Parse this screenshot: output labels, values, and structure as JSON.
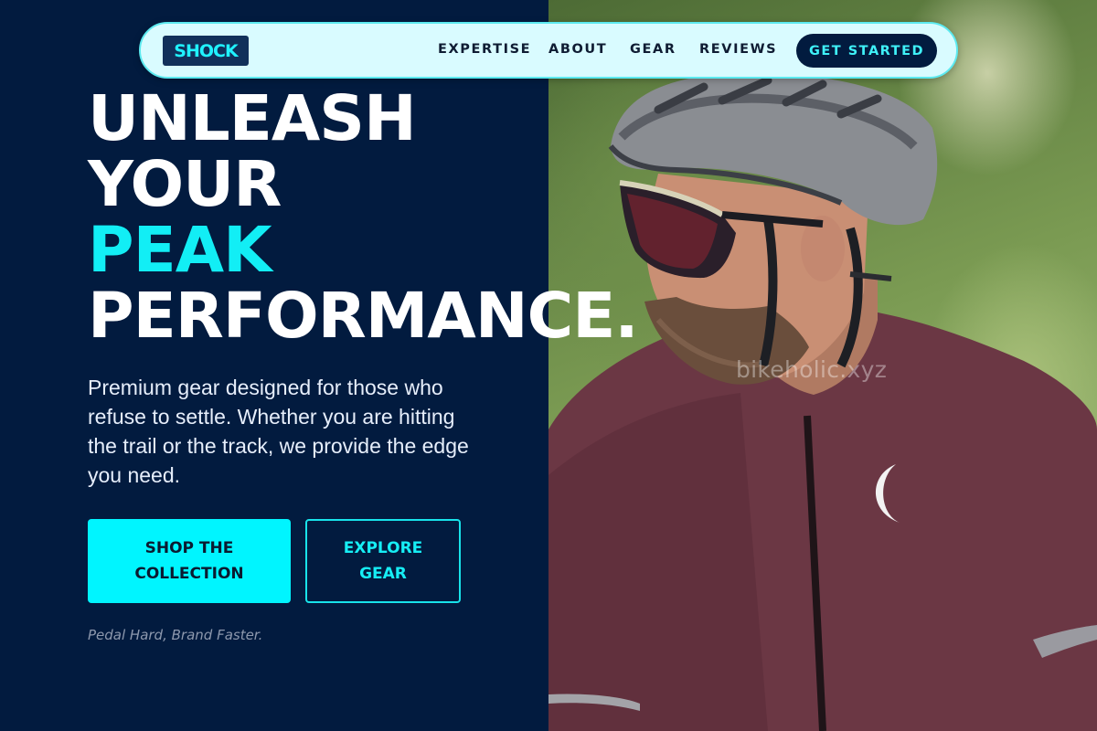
{
  "nav": {
    "logo": "SHOCK",
    "links": [
      "EXPERTISE",
      "ABOUT",
      "GEAR",
      "REVIEWS"
    ],
    "cta": "GET STARTED"
  },
  "hero": {
    "headline": {
      "line1": "UNLEASH",
      "line2": "YOUR",
      "line3": "PEAK",
      "line4": "PERFORMANCE."
    },
    "subtext": "Premium gear designed for those who refuse to settle. Whether you are hitting the trail or the track, we provide the edge you need.",
    "primary_button": "SHOP THE COLLECTION",
    "secondary_button": "EXPLORE GEAR",
    "tagline": "Pedal Hard, Brand Faster.",
    "image_watermark": "bikeholic.xyz"
  },
  "colors": {
    "navy": "#021b3f",
    "accent_cyan": "#00f5ff",
    "nav_background": "#d9fbff",
    "jersey": "#6b3744"
  },
  "icons": {
    "photo": "cyclist-portrait-photo"
  }
}
